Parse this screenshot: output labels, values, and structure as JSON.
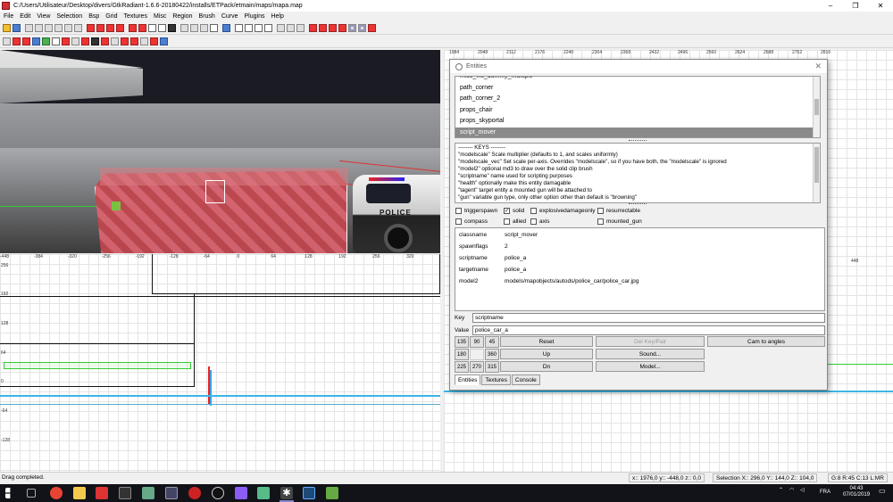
{
  "window": {
    "title": "C:/Users/Utilisateur/Desktop/divers/GtkRadiant-1.6.6-20180422/installs/ETPack/etmain/maps/mapa.map",
    "controls": [
      "–",
      "❐",
      "✕"
    ]
  },
  "menu": [
    "File",
    "Edit",
    "View",
    "Selection",
    "Bsp",
    "Grid",
    "Textures",
    "Misc",
    "Region",
    "Brush",
    "Curve",
    "Plugins",
    "Help"
  ],
  "camera": {
    "vehicle_text": "POLICE"
  },
  "xy_view": {
    "ruler": [
      "-448",
      "-384",
      "-320",
      "-256",
      "-192",
      "-128",
      "-64",
      "0",
      "64",
      "128",
      "192",
      "256",
      "320",
      "384",
      "448"
    ],
    "vlabels": [
      "256",
      "192",
      "128",
      "64",
      "0",
      "-64",
      "-128"
    ]
  },
  "right_view": {
    "ruler": [
      "1984",
      "2048",
      "2112",
      "2176",
      "2240",
      "2304",
      "2368",
      "2432",
      "2496",
      "2560",
      "2624",
      "2688",
      "2752",
      "2816"
    ],
    "ruler2": [
      "384",
      "448"
    ]
  },
  "entities": {
    "title": "Entities",
    "classnames": [
      "misc_vis_dummy_multiple",
      "path_corner",
      "path_corner_2",
      "props_chair",
      "props_skyportal",
      "script_mover"
    ],
    "selected_classname": "script_mover",
    "keys_text": [
      "-------- KEYS --------",
      "\"modelscale\" Scale multiplier (defaults to 1, and scales uniformly)",
      "\"modelscale_vec\" Set scale per-axis.  Overrides \"modelscale\", so if you have both, the \"modelscale\" is ignored",
      "\"model2\" optional md3 to draw over the solid clip brush",
      "\"scriptname\" name used for scripting purposes",
      "\"health\" optionally make this entity damagable",
      "\"tagent\" target entity a mounted gun will be attached to",
      "\"gun\" variable gun type, only other option other than default is \"browning\""
    ],
    "flags": [
      {
        "label": "triggerspawn",
        "checked": false
      },
      {
        "label": "solid",
        "checked": true
      },
      {
        "label": "explosivedamageonly",
        "checked": false
      },
      {
        "label": "resurrectable",
        "checked": false
      },
      {
        "label": "compass",
        "checked": false
      },
      {
        "label": "allied",
        "checked": false
      },
      {
        "label": "axis",
        "checked": false
      },
      {
        "label": "mounted_gun",
        "checked": false
      }
    ],
    "properties": [
      {
        "key": "classname",
        "value": "script_mover"
      },
      {
        "key": "spawnflags",
        "value": "2"
      },
      {
        "key": "scriptname",
        "value": "police_a"
      },
      {
        "key": "targetname",
        "value": "police_a"
      },
      {
        "key": "model2",
        "value": "models/mapobjects/autods/police_car/police_car.jpg"
      }
    ],
    "key_label": "Key",
    "key_value": "scriptname",
    "value_label": "Value",
    "value_value": "police_car_a",
    "angles": [
      "135",
      "90",
      "45",
      "180",
      "",
      "360",
      "225",
      "270",
      "315"
    ],
    "buttons": {
      "reset": "Reset",
      "del_key_pair": "Del Key/Pair",
      "cam_to_angles": "Cam to angles",
      "up": "Up",
      "sound": "Sound...",
      "dn": "Dn",
      "model": "Model..."
    },
    "tabs": [
      "Entities",
      "Textures",
      "Console"
    ]
  },
  "status": {
    "message": "Drag completed.",
    "coords": "x:: 1976,0  y:: -448,0  z:: 0,0",
    "selection": "Selection X:: 296,0  Y:: 144,0  Z:: 104,0",
    "grid": "G:8 R:45 C:13 L:MR"
  },
  "taskbar": {
    "tray_lang": "FRA",
    "time": "04:43",
    "date": "07/01/2019"
  },
  "colors": {
    "selection_red": "#d86470",
    "axis_green": "#33cc33",
    "axis_cyan": "#3bb5e6",
    "selected_row": "#8a8a8a"
  }
}
